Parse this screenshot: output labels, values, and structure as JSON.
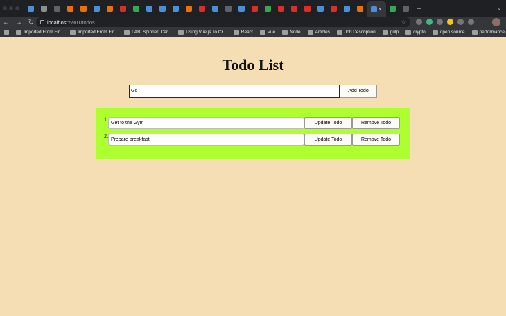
{
  "browser": {
    "url_host": "localhost",
    "url_path": ":5901/todos",
    "tab_colors": [
      "#4a90d9",
      "#8e8e8e",
      "#5f6368",
      "#e8710a",
      "#e8710a",
      "#4a90d9",
      "#e8710a",
      "#d93025",
      "#34a853",
      "#4a90d9",
      "#4a90d9",
      "#4a90d9",
      "#e8710a",
      "#d93025",
      "#4a90d9",
      "#5f6368",
      "#4a90d9",
      "#d93025",
      "#34a853",
      "#d93025",
      "#d93025",
      "#d93025",
      "#4a90d9",
      "#d93025",
      "#4a90d9",
      "#e8710a",
      "#4a90d9",
      "#34a853",
      "#5f6368"
    ],
    "bookmarks": [
      {
        "label": "Imported From Fir..."
      },
      {
        "label": "Imported From Fir..."
      },
      {
        "label": "LAB: Spinner, Car..."
      },
      {
        "label": "Using Vue.js To Cr..."
      },
      {
        "label": "React"
      },
      {
        "label": "Vue"
      },
      {
        "label": "Node"
      },
      {
        "label": "Articles"
      },
      {
        "label": "Job Description"
      },
      {
        "label": "gulp"
      },
      {
        "label": "crypto"
      },
      {
        "label": "open source"
      },
      {
        "label": "performance"
      }
    ]
  },
  "app": {
    "title": "Todo List",
    "new_todo_value": "Go",
    "add_button_label": "Add Todo",
    "list_bg_color": "#adff2f",
    "page_bg_color": "#f5deb3",
    "todos": [
      {
        "number": "1.",
        "text": "Get to the Gym",
        "update_label": "Update Todo",
        "remove_label": "Remove Todo"
      },
      {
        "number": "2.",
        "text": "Prepare breakfast",
        "update_label": "Update Todo",
        "remove_label": "Remove Todo"
      }
    ]
  }
}
